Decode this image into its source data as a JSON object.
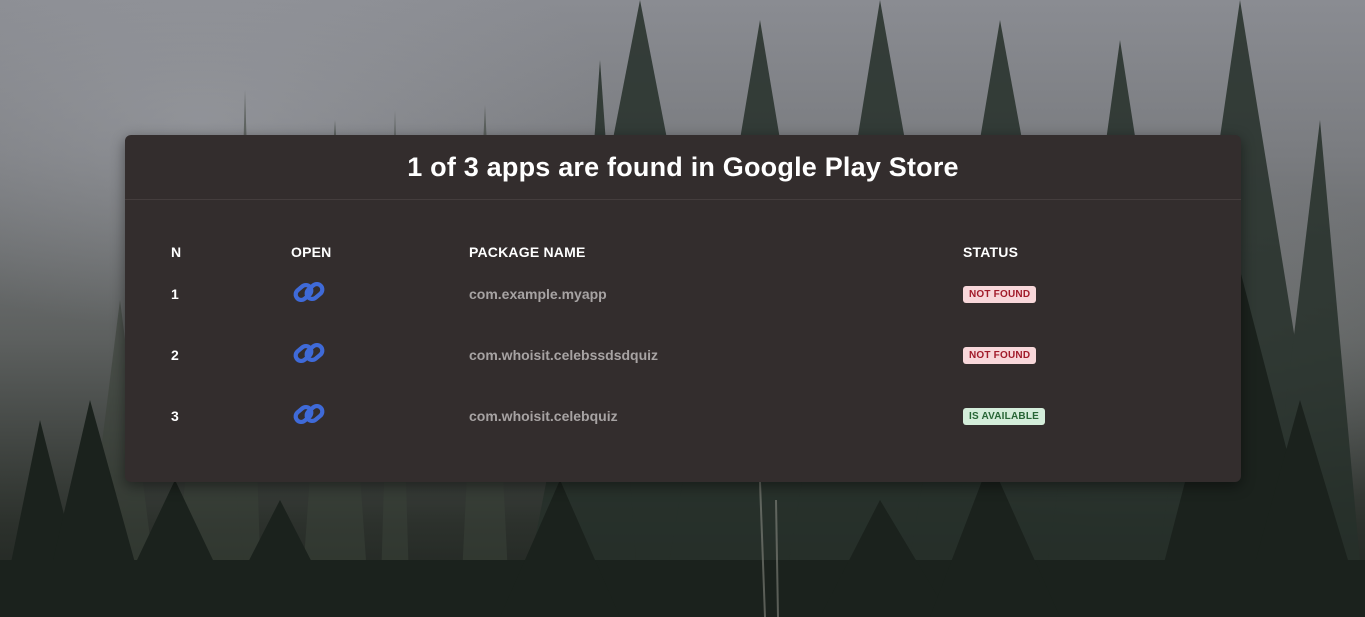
{
  "title": "1 of 3 apps are found in Google Play Store",
  "columns": {
    "n": "N",
    "open": "OPEN",
    "package": "PACKAGE NAME",
    "status": "STATUS"
  },
  "rows": [
    {
      "n": "1",
      "package": "com.example.myapp",
      "status": "NOT FOUND",
      "status_kind": "not-found",
      "icon": "link-icon"
    },
    {
      "n": "2",
      "package": "com.whoisit.celebssdsdquiz",
      "status": "NOT FOUND",
      "status_kind": "not-found",
      "icon": "link-icon"
    },
    {
      "n": "3",
      "package": "com.whoisit.celebquiz",
      "status": "IS AVAILABLE",
      "status_kind": "available",
      "icon": "link-icon"
    }
  ],
  "colors": {
    "card": "#332d2d",
    "link": "#3f6ad8",
    "not_found_bg": "#f8d7da",
    "not_found_text": "#a11b2a",
    "available_bg": "#d4edda",
    "available_text": "#276535"
  }
}
